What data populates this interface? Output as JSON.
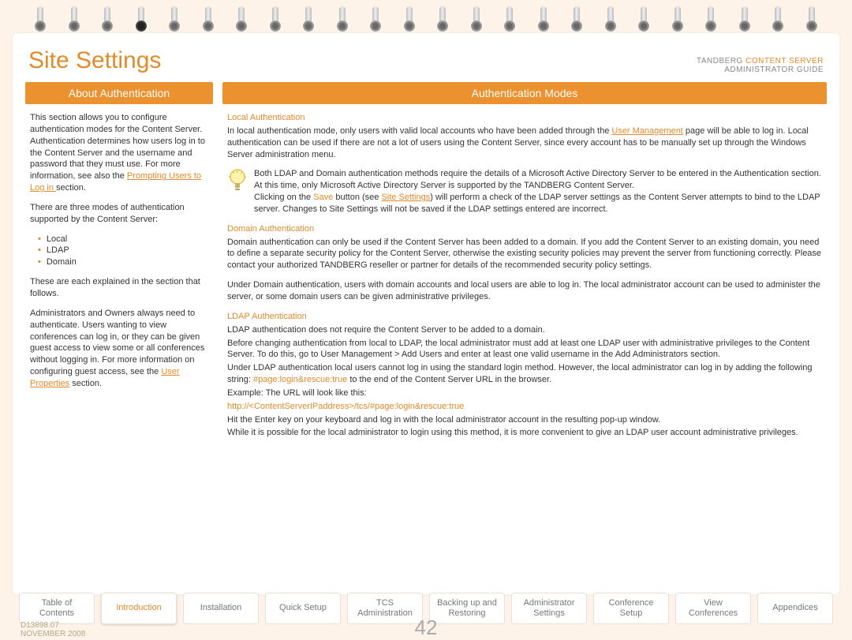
{
  "header": {
    "title": "Site Settings",
    "brand_line1a": "TANDBERG ",
    "brand_line1b": "CONTENT SERVER",
    "brand_line2": "ADMINISTRATOR GUIDE"
  },
  "left": {
    "col_title": "About Authentication",
    "p1a": "This section allows you to configure authentication modes for the Content Server. Authentication determines how users log in to the Content Server and the username and password that they must use. For more information, see also the ",
    "p1_link": "Prompting Users to Log in ",
    "p1b": "section.",
    "p2": "There are three modes of authentication supported by the Content Server:",
    "modes": [
      "Local",
      "LDAP",
      "Domain"
    ],
    "p3": "These are each explained in the section that follows.",
    "p4a": "Administrators and Owners always need to authenticate. Users wanting to view conferences can log in, or they can be given guest access to view some or all conferences without logging in. For more information on configuring guest access, see the ",
    "p4_link": "User Properties",
    "p4b": " section."
  },
  "right": {
    "col_title": "Authentication Modes",
    "local_head": "Local Authentication",
    "local_p1a": "In local authentication mode, only users with valid local accounts who have been added through the ",
    "local_p1_link": "User Management",
    "local_p1b": " page will be able to log in. Local authentication can be used if there are not a lot of users using the Content Server, since every account has to be manually set up through the Windows Server administration menu.",
    "tip_l1": "Both LDAP and Domain authentication methods require the details of a Microsoft Active Directory Server to be entered in the Authentication section. At this time, only Microsoft Active Directory Server is supported by the TANDBERG Content Server.",
    "tip_l2a": "Clicking on the ",
    "tip_l2_save": "Save",
    "tip_l2b": " button (see ",
    "tip_l2_link": "Site Settings",
    "tip_l2c": ") will perform a check of the LDAP server settings as the Content Server attempts to bind to the LDAP server. Changes to Site Settings will not be saved if the LDAP settings entered are incorrect.",
    "domain_head": "Domain Authentication",
    "domain_p1": "Domain authentication can only be used if the Content Server has been added to a domain. If you add the Content Server to an existing domain, you need to define a separate security policy for the Content Server, otherwise the existing security policies may prevent the server from functioning correctly. Please contact your authorized TANDBERG reseller or partner for details of the recommended security policy settings.",
    "domain_p2": "Under Domain authentication, users with domain accounts and local users are able to log in. The local administrator account can be used to administer the server, or some domain users can be given administrative privileges.",
    "ldap_head": "LDAP Authentication",
    "ldap_p1": "LDAP authentication does not require the Content Server to be added to a domain.",
    "ldap_p2": "Before changing authentication from local to LDAP, the local administrator must add at least one LDAP user with administrative privileges to the Content Server. To do this, go to User Management > Add Users and enter at least one valid username in the Add Administrators section.",
    "ldap_p3a": "Under LDAP authentication local users cannot log in using the standard login method. However, the local administrator can log in by adding the following string: ",
    "ldap_p3_code": "#page:login&rescue:true",
    "ldap_p3b": " to the end of the Content Server URL in the browser.",
    "ldap_p4": "Example: The URL will look like this:",
    "ldap_url": "http://<ContentServerIPaddress>/tcs/#page:login&rescue:true",
    "ldap_p5": "Hit the Enter key on your keyboard and log in with the local administrator account in the resulting pop-up window.",
    "ldap_p6": "While it is possible for the local administrator to login using this method, it is more convenient to give an LDAP user account administrative privileges."
  },
  "nav": [
    {
      "l1": "Table of",
      "l2": "Contents"
    },
    {
      "l1": "Introduction",
      "l2": ""
    },
    {
      "l1": "Installation",
      "l2": ""
    },
    {
      "l1": "Quick Setup",
      "l2": ""
    },
    {
      "l1": "TCS",
      "l2": "Administration"
    },
    {
      "l1": "Backing up and",
      "l2": "Restoring"
    },
    {
      "l1": "Administrator",
      "l2": "Settings"
    },
    {
      "l1": "Conference",
      "l2": "Setup"
    },
    {
      "l1": "View",
      "l2": "Conferences"
    },
    {
      "l1": "Appendices",
      "l2": ""
    }
  ],
  "nav_active_index": 1,
  "footer": {
    "doc_id": "D13898.07",
    "date": "NOVEMBER 2008",
    "page": "42"
  }
}
